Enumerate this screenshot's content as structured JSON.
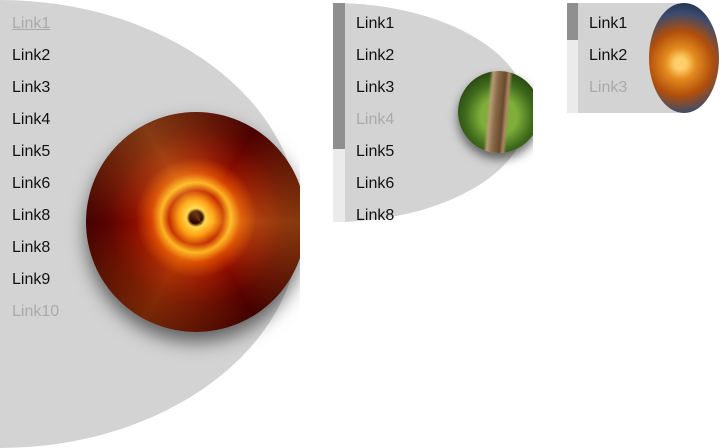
{
  "menu1": {
    "links": [
      "Link1",
      "Link2",
      "Link3",
      "Link4",
      "Link5",
      "Link6",
      "Link8",
      "Link8",
      "Link9",
      "Link10"
    ],
    "image": "spiral-galaxy-fire"
  },
  "menu2": {
    "links": [
      "Link1",
      "Link2",
      "Link3",
      "Link4",
      "Link5",
      "Link6",
      "Link8"
    ],
    "image": "forest-boardwalk"
  },
  "menu3": {
    "links": [
      "Link1",
      "Link2",
      "Link3"
    ],
    "image": "orange-glass-sphere"
  },
  "colors": {
    "panel": "#d3d3d3",
    "link": "#111111",
    "link_dim": "#a9a9a9",
    "scroll_thumb": "#8f8f8f",
    "scroll_track": "#ebebeb"
  }
}
